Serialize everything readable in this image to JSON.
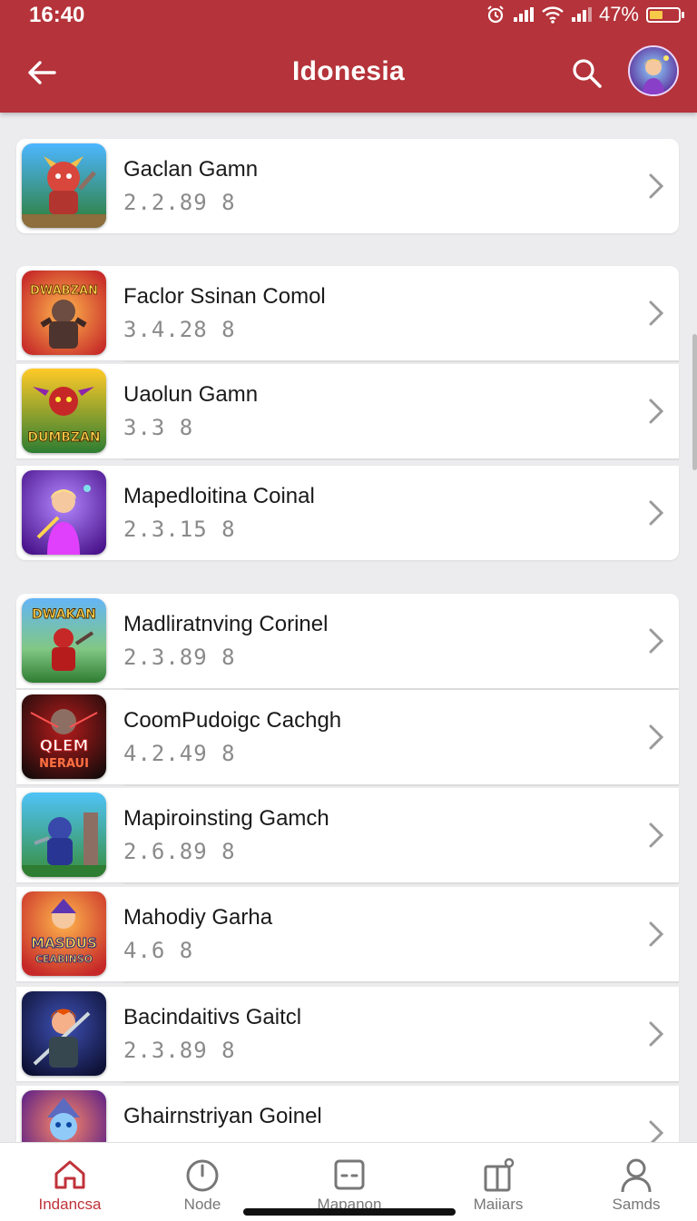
{
  "status_bar": {
    "time": "16:40",
    "battery": "47%",
    "battery_level": 0.47
  },
  "header": {
    "title": "Idonesia"
  },
  "games": [
    {
      "name": "Gaclan Gamn",
      "version": "2.2.89 8",
      "icon": "hero-red-warrior-icon"
    },
    {
      "name": "Faclor Ssinan Comol",
      "version": "3.4.28 8",
      "icon": "barbarian-fire-icon"
    },
    {
      "name": "Uaolun Gamn",
      "version": "3.3 8",
      "icon": "dragon-gold-icon"
    },
    {
      "name": "Mapedloitina Coinal",
      "version": "2.3.15 8",
      "icon": "fairy-queen-icon"
    },
    {
      "name": "Madliratnving Corinel",
      "version": "2.3.89 8",
      "icon": "red-knight-field-icon"
    },
    {
      "name": "CoomPudoigc Cachgh",
      "version": "4.2.49 8",
      "icon": "dark-hero-icon"
    },
    {
      "name": "Mapiroinsting Gamch",
      "version": "2.6.89 8",
      "icon": "ninja-tower-icon"
    },
    {
      "name": "Mahodiy Garha",
      "version": "4.6 8",
      "icon": "magic-heroes-icon"
    },
    {
      "name": "Bacindaitivs Gaitcl",
      "version": "2.3.89 8",
      "icon": "sword-hero-icon"
    },
    {
      "name": "Ghairnstriyan Goinel",
      "version": "",
      "icon": "blue-hero-icon"
    }
  ],
  "thumb_text": {
    "t1": "DWABZAN",
    "t2": "DUMBZAN",
    "t4": "DWAKAN",
    "t5a": "QLEM",
    "t5b": "NERAUI",
    "t7a": "MASDUS",
    "t7b": "CEABINSO"
  },
  "bottom_nav": [
    {
      "label": "Indancsa",
      "icon": "home-icon",
      "active": true
    },
    {
      "label": "Node",
      "icon": "clock-icon",
      "active": false
    },
    {
      "label": "Mapanon",
      "icon": "card-icon",
      "active": false
    },
    {
      "label": "Maiiars",
      "icon": "gift-icon",
      "active": false
    },
    {
      "label": "Samds",
      "icon": "profile-icon",
      "active": false
    }
  ],
  "colors": {
    "app_bar": "#b5333a",
    "accent": "#c0323a",
    "background": "#ececee"
  }
}
